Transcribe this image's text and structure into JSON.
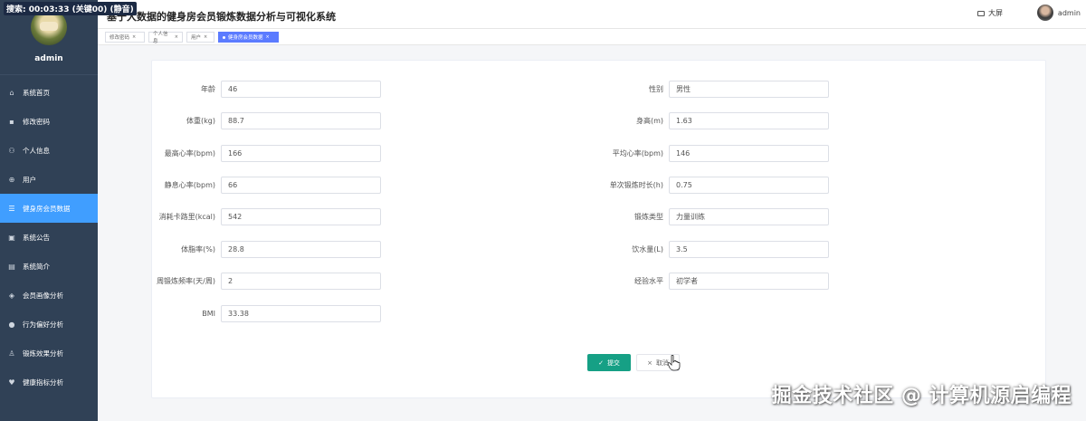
{
  "overlay": {
    "recording_text": "搜索: 00:03:33 (关键00) (静音)"
  },
  "sidebar": {
    "username": "admin",
    "items": [
      {
        "label": "系统首页",
        "icon": "home-icon",
        "glyph": "⌂",
        "active": false
      },
      {
        "label": "修改密码",
        "icon": "lock-icon",
        "glyph": "▪",
        "active": false
      },
      {
        "label": "个人信息",
        "icon": "user-icon",
        "glyph": "⚇",
        "active": false
      },
      {
        "label": "用户",
        "icon": "globe-icon",
        "glyph": "⊕",
        "active": false
      },
      {
        "label": "健身房会员数据",
        "icon": "list-icon",
        "glyph": "☰",
        "active": true
      },
      {
        "label": "系统公告",
        "icon": "notice-icon",
        "glyph": "▣",
        "active": false
      },
      {
        "label": "系统简介",
        "icon": "document-icon",
        "glyph": "▤",
        "active": false
      },
      {
        "label": "会员画像分析",
        "icon": "chart-icon",
        "glyph": "◈",
        "active": false
      },
      {
        "label": "行为偏好分析",
        "icon": "location-icon",
        "glyph": "●",
        "active": false
      },
      {
        "label": "锻炼效果分析",
        "icon": "person-icon",
        "glyph": "♙",
        "active": false
      },
      {
        "label": "健康指标分析",
        "icon": "heart-icon",
        "glyph": "♥",
        "active": false
      }
    ]
  },
  "header": {
    "title": "基于大数据的健身房会员锻炼数据分析与可视化系统",
    "screen_label": "大屏",
    "user_label": "admin"
  },
  "tags": [
    {
      "label": "修改密码",
      "active": false
    },
    {
      "label": "个人信息",
      "active": false
    },
    {
      "label": "用户",
      "active": false
    },
    {
      "label": "健身房会员数据",
      "active": true
    }
  ],
  "form": {
    "left": [
      {
        "label": "年龄",
        "value": "46"
      },
      {
        "label": "体重(kg)",
        "value": "88.7"
      },
      {
        "label": "最高心率(bpm)",
        "value": "166"
      },
      {
        "label": "静息心率(bpm)",
        "value": "66"
      },
      {
        "label": "消耗卡路里(kcal)",
        "value": "542"
      },
      {
        "label": "体脂率(%)",
        "value": "28.8"
      },
      {
        "label": "周锻炼频率(天/周)",
        "value": "2"
      },
      {
        "label": "BMI",
        "value": "33.38"
      }
    ],
    "right": [
      {
        "label": "性别",
        "value": "男性"
      },
      {
        "label": "身高(m)",
        "value": "1.63"
      },
      {
        "label": "平均心率(bpm)",
        "value": "146"
      },
      {
        "label": "单次锻炼时长(h)",
        "value": "0.75"
      },
      {
        "label": "锻炼类型",
        "value": "力量训练"
      },
      {
        "label": "饮水量(L)",
        "value": "3.5"
      },
      {
        "label": "经验水平",
        "value": "初学者"
      }
    ],
    "submit_label": "提交",
    "cancel_label": "取消"
  },
  "watermark": "掘金技术社区 @ 计算机源启编程",
  "colors": {
    "sidebar_bg": "#304156",
    "active_menu": "#409eff",
    "active_tag": "#5b7bff",
    "submit": "#16a085"
  }
}
